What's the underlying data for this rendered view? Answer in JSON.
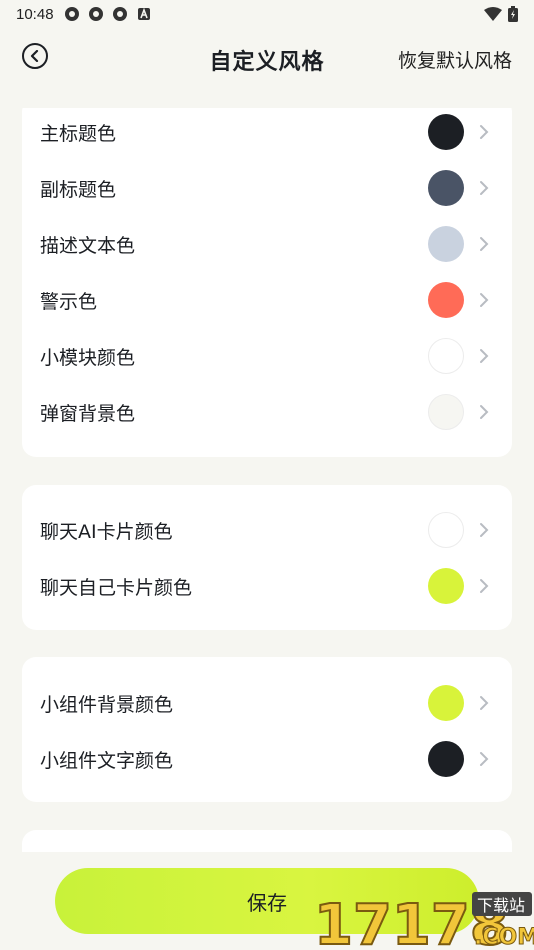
{
  "status_bar": {
    "time": "10:48"
  },
  "header": {
    "title": "自定义风格",
    "reset_label": "恢复默认风格"
  },
  "groups": [
    {
      "items": [
        {
          "label": "主标题色",
          "color": "#1c1f24"
        },
        {
          "label": "副标题色",
          "color": "#4a5466"
        },
        {
          "label": "描述文本色",
          "color": "#c9d2df"
        },
        {
          "label": "警示色",
          "color": "#ff6b57"
        },
        {
          "label": "小模块颜色",
          "color": "#ffffff"
        },
        {
          "label": "弹窗背景色",
          "color": "#f6f6f2"
        }
      ]
    },
    {
      "items": [
        {
          "label": "聊天AI卡片颜色",
          "color": "#ffffff"
        },
        {
          "label": "聊天自己卡片颜色",
          "color": "#d8f33a"
        }
      ]
    },
    {
      "items": [
        {
          "label": "小组件背景颜色",
          "color": "#d8f33a"
        },
        {
          "label": "小组件文字颜色",
          "color": "#1c1f24"
        }
      ]
    }
  ],
  "save_button": {
    "label": "保存"
  },
  "watermark": {
    "main": "17178",
    "sub": "下载站",
    "domain": ".COM"
  }
}
